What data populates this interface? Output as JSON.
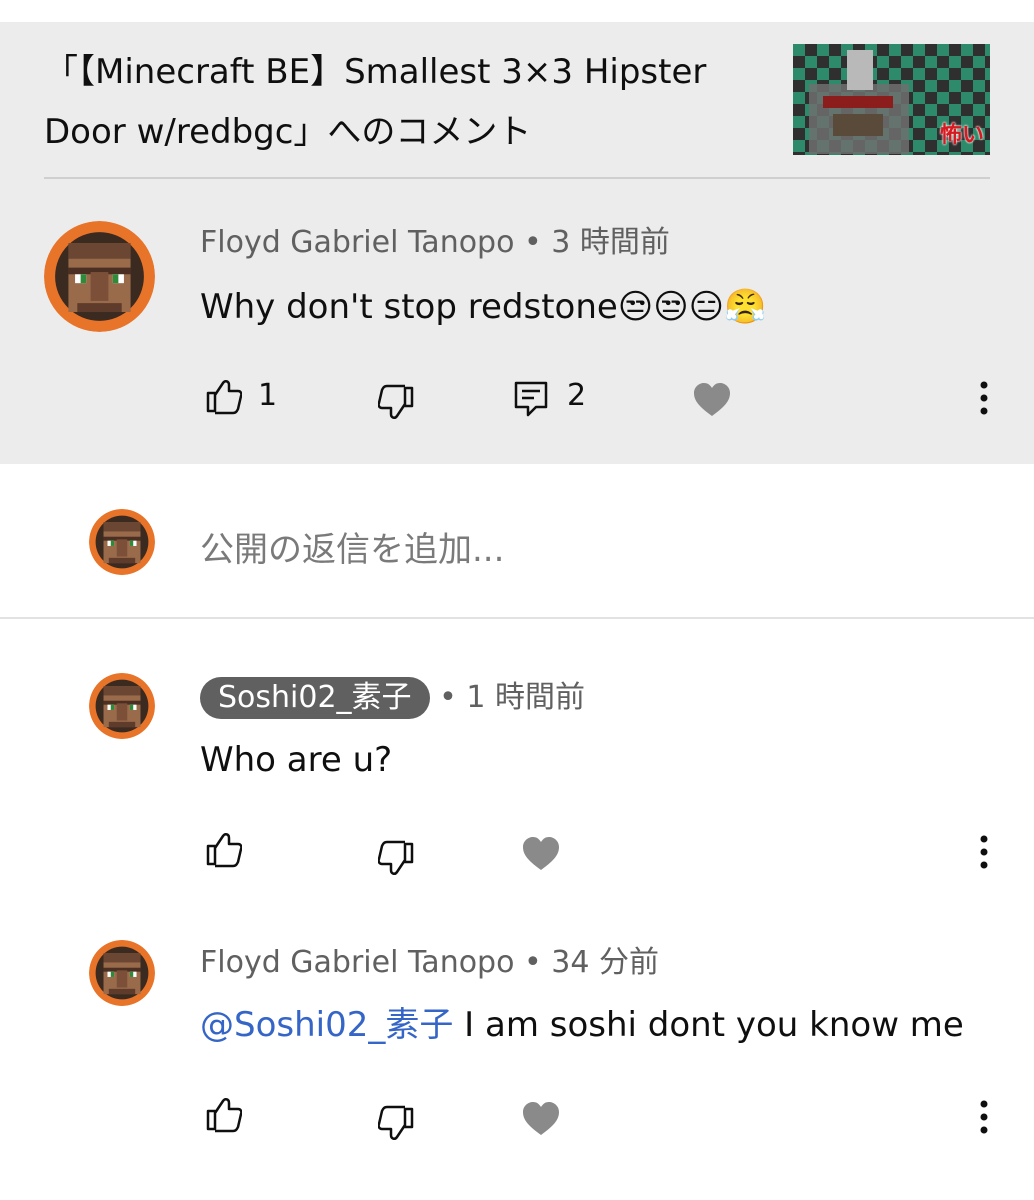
{
  "header": {
    "title": "「【Minecraft BE】Smallest 3×3 Hipster Door  w/redbgc」へのコメント",
    "thumbnail_label": "怖い"
  },
  "comment": {
    "author": "Floyd Gabriel Tanopo",
    "time": "• 3 時間前",
    "text": "Why don't stop redstone",
    "emojis": "😒😒😑😤",
    "like_count": "1",
    "reply_count": "2"
  },
  "reply_box": {
    "placeholder": "公開の返信を追加..."
  },
  "replies": [
    {
      "author": "Soshi02_素子",
      "time": "• 1 時間前",
      "text": "Who are u?"
    },
    {
      "author": "Floyd Gabriel Tanopo",
      "time": "• 34 分前",
      "mention": "@Soshi02_素子",
      "text": "I am soshi dont you know me"
    }
  ],
  "colors": {
    "panel_bg": "#ececec",
    "mention": "#3465c7",
    "avatar_ring": "#e8742a",
    "chip_bg": "#606060"
  }
}
